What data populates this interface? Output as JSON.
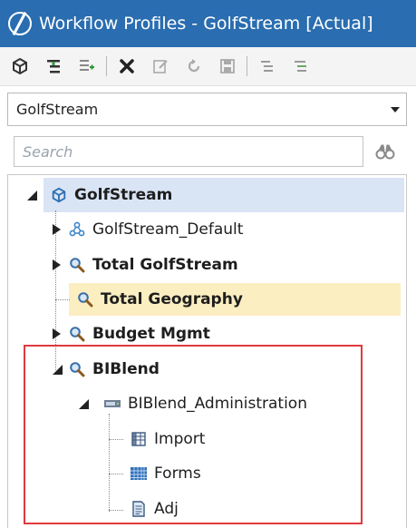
{
  "window": {
    "title": "Workflow Profiles - GolfStream [Actual]"
  },
  "toolbar": {
    "buttons": [
      {
        "icon": "cube-icon"
      },
      {
        "icon": "insert-child-icon"
      },
      {
        "icon": "insert-sibling-icon"
      },
      {
        "icon": "delete-icon"
      },
      {
        "icon": "edit-icon"
      },
      {
        "icon": "refresh-icon"
      },
      {
        "icon": "save-icon"
      },
      {
        "icon": "collapse-all-icon"
      },
      {
        "icon": "expand-all-icon"
      }
    ]
  },
  "dropdown": {
    "selected": "GolfStream"
  },
  "search": {
    "placeholder": "Search",
    "value": ""
  },
  "tree": [
    {
      "label": "GolfStream",
      "icon": "cube-icon",
      "level": 0,
      "expanded": true,
      "bold": true
    },
    {
      "label": "GolfStream_Default",
      "icon": "network-icon",
      "level": 1,
      "expanded": false,
      "bold": false
    },
    {
      "label": "Total GolfStream",
      "icon": "magnifier-icon",
      "level": 1,
      "expanded": false,
      "bold": true
    },
    {
      "label": "Total Geography",
      "icon": "magnifier-icon",
      "level": 1,
      "bold": true,
      "selected": true
    },
    {
      "label": "Budget Mgmt",
      "icon": "magnifier-icon",
      "level": 1,
      "expanded": false,
      "bold": true
    },
    {
      "label": "BIBlend",
      "icon": "magnifier-icon",
      "level": 1,
      "expanded": true,
      "bold": true
    },
    {
      "label": "BIBlend_Administration",
      "icon": "server-icon",
      "level": 2,
      "expanded": true,
      "bold": false
    },
    {
      "label": "Import",
      "icon": "import-grid-icon",
      "level": 3,
      "bold": false
    },
    {
      "label": "Forms",
      "icon": "forms-grid-icon",
      "level": 3,
      "bold": false
    },
    {
      "label": "Adj",
      "icon": "document-icon",
      "level": 3,
      "bold": false
    }
  ],
  "colors": {
    "titlebar": "#2a6db0",
    "root_highlight": "#d9e4f5",
    "selection_highlight": "#fbeec1",
    "annotation_box": "#e0393e"
  }
}
